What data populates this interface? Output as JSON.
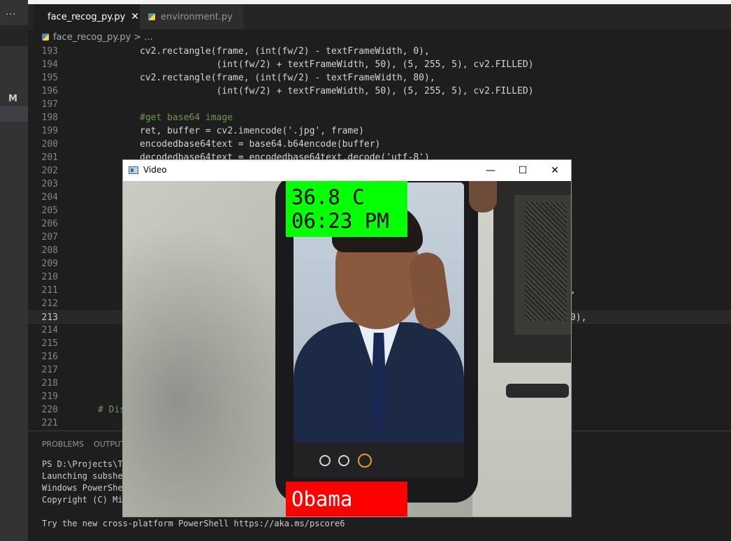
{
  "activity_bar": {
    "more_label": "···",
    "scm_badge": "M"
  },
  "tabs": [
    {
      "label": "face_recog_py.py",
      "close": "✕"
    },
    {
      "label": "environment.py"
    }
  ],
  "breadcrumb": {
    "file": "face_recog_py.py",
    "sep": ">",
    "rest": "..."
  },
  "editor": {
    "lines": [
      {
        "n": "193",
        "text": "cv2.rectangle(frame, (int(fw/2) - textFrameWidth, 0),"
      },
      {
        "n": "194",
        "text": "              (int(fw/2) + textFrameWidth, 50), (5, 255, 5), cv2.FILLED)"
      },
      {
        "n": "195",
        "text": "cv2.rectangle(frame, (int(fw/2) - textFrameWidth, 80),"
      },
      {
        "n": "196",
        "text": "              (int(fw/2) + textFrameWidth, 50), (5, 255, 5), cv2.FILLED)"
      },
      {
        "n": "197",
        "text": ""
      },
      {
        "n": "198",
        "text": "#get base64 image"
      },
      {
        "n": "199",
        "text": "ret, buffer = cv2.imencode('.jpg', frame)"
      },
      {
        "n": "200",
        "text": "encodedbase64text = base64.b64encode(buffer)"
      },
      {
        "n": "201",
        "text": "decodedbase64text = encodedbase64text.decode('utf-8')"
      },
      {
        "n": "202",
        "text": ""
      },
      {
        "n": "203",
        "text": ""
      },
      {
        "n": "204",
        "text": ""
      },
      {
        "n": "205",
        "text": ""
      },
      {
        "n": "206",
        "text": ""
      },
      {
        "n": "207",
        "text": ""
      },
      {
        "n": "208",
        "text": ""
      },
      {
        "n": "209",
        "text": ""
      },
      {
        "n": "210",
        "text": ""
      },
      {
        "n": "211",
        "text": ""
      },
      {
        "n": "212",
        "text": ""
      },
      {
        "n": "213",
        "text": ""
      },
      {
        "n": "214",
        "text": ""
      },
      {
        "n": "215",
        "text": ""
      },
      {
        "n": "216",
        "text": ""
      },
      {
        "n": "217",
        "text": ""
      },
      {
        "n": "218",
        "text": ""
      },
      {
        "n": "219",
        "text": ""
      },
      {
        "n": "220",
        "text": "# Dis"
      },
      {
        "n": "221",
        "text": ""
      }
    ],
    "fragment_211": ",",
    "fragment_213": "0),"
  },
  "panel": {
    "tabs": [
      "PROBLEMS",
      "OUTPUT"
    ],
    "terminal": [
      "PS D:\\Projects\\Th",
      "Launching subshel",
      "Windows PowerShel",
      "Copyright (C) Mic",
      "",
      "Try the new cross-platform PowerShell https://aka.ms/pscore6"
    ]
  },
  "video_window": {
    "title": "Video",
    "minimize": "—",
    "maximize": "☐",
    "close": "✕",
    "overlay_temperature": "36.8 C",
    "overlay_time": "06:23 PM",
    "overlay_name": "Obama",
    "temp_box_color": "#05ff05",
    "name_box_color": "#ff0000"
  }
}
